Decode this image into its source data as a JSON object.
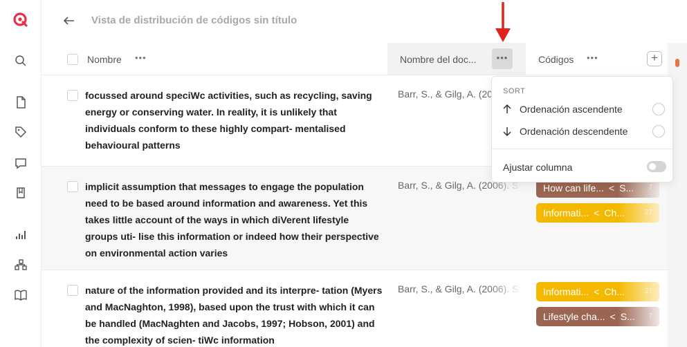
{
  "app": {
    "title": "Vista de distribución de códigos sin título",
    "accent_color": "#e8304a"
  },
  "sidebar": {
    "icons": [
      "logo-icon",
      "search-icon",
      "document-icon",
      "tag-icon",
      "comment-icon",
      "bookmark-icon",
      "chart-icon",
      "network-icon",
      "book-icon"
    ]
  },
  "columns": {
    "name": "Nombre",
    "document": "Nombre del doc...",
    "codes": "Códigos",
    "dots": "•••",
    "plus": "+"
  },
  "rows": [
    {
      "text": "focussed around speciWc activities, such as recycling, saving energy or conserving water. In reality, it is unlikely that individuals conform to these highly compart- mentalised behavioural patterns",
      "document": "Barr, S., & Gilg, A. (2006). S",
      "tags": []
    },
    {
      "text": "implicit assumption that messages to engage the population need to be based around information and awareness. Yet this takes little account of the ways in which diVerent lifestyle groups uti- lise this information or indeed how their perspective on environmental action varies",
      "document": "Barr, S., & Gilg, A. (2006). S",
      "tags": [
        {
          "label": "How can life...",
          "sep": "<",
          "sub": "S...",
          "count": "7",
          "color": "#9a6652"
        },
        {
          "label": "Informati...",
          "sep": "<",
          "sub": "Ch...",
          "count": "27",
          "color": "#f5b800"
        }
      ]
    },
    {
      "text": "nature of the information provided and its interpre- tation (Myers and MacNaghton, 1998), based upon the trust with which it can be handled (MacNaghten and Jacobs, 1997; Hobson, 2001) and the complexity of scien- tiWc information",
      "document": "Barr, S., & Gilg, A. (2006). S",
      "tags": [
        {
          "label": "Informati...",
          "sep": "<",
          "sub": "Ch...",
          "count": "27",
          "color": "#f5b800"
        },
        {
          "label": "Lifestyle cha...",
          "sep": "<",
          "sub": "S...",
          "count": "7",
          "color": "#9a6652"
        }
      ]
    }
  ],
  "column_menu": {
    "section": "SORT",
    "sort_asc": "Ordenación ascendente",
    "sort_desc": "Ordenación descendente",
    "fit_column": "Ajustar columna",
    "fit_column_enabled": false
  },
  "annotation": {
    "arrow_color": "#e0231c"
  }
}
